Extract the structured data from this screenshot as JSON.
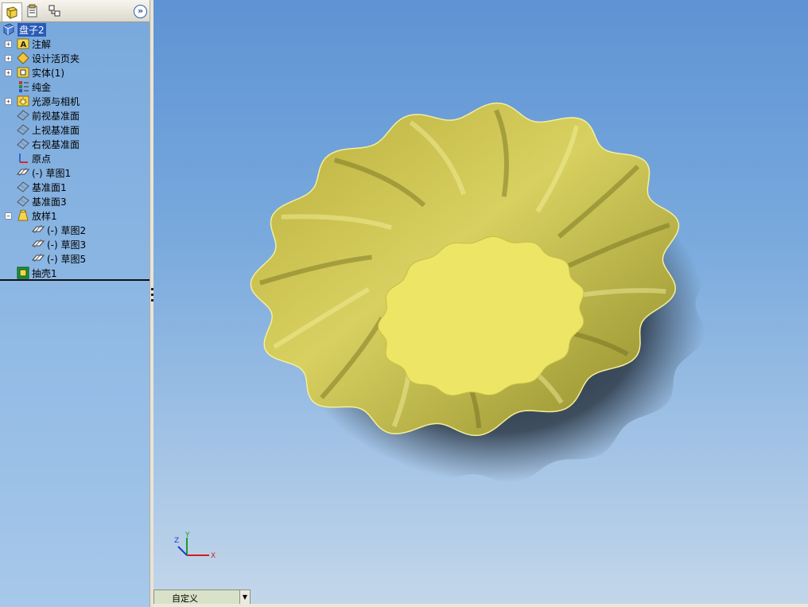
{
  "panel_tabs": [
    {
      "name": "feature-manager-tab"
    },
    {
      "name": "property-manager-tab"
    },
    {
      "name": "configuration-manager-tab"
    }
  ],
  "expand_label": "»",
  "tree": {
    "root": "盘子2",
    "items": [
      {
        "label": "注解",
        "icon": "annotations-icon",
        "toggle": "+"
      },
      {
        "label": "设计活页夹",
        "icon": "design-binder-icon",
        "toggle": "+"
      },
      {
        "label": "实体(1)",
        "icon": "solid-bodies-icon",
        "toggle": "+"
      },
      {
        "label": "纯金",
        "icon": "material-icon",
        "toggle": ""
      },
      {
        "label": "光源与相机",
        "icon": "lights-cameras-icon",
        "toggle": "+"
      },
      {
        "label": "前视基准面",
        "icon": "plane-icon",
        "toggle": ""
      },
      {
        "label": "上视基准面",
        "icon": "plane-icon",
        "toggle": ""
      },
      {
        "label": "右视基准面",
        "icon": "plane-icon",
        "toggle": ""
      },
      {
        "label": "原点",
        "icon": "origin-icon",
        "toggle": ""
      },
      {
        "label": "(-) 草图1",
        "icon": "sketch-icon",
        "toggle": ""
      },
      {
        "label": "基准面1",
        "icon": "plane-icon",
        "toggle": ""
      },
      {
        "label": "基准面3",
        "icon": "plane-icon",
        "toggle": ""
      },
      {
        "label": "放样1",
        "icon": "loft-icon",
        "toggle": "−"
      },
      {
        "label": "(-) 草图2",
        "icon": "sketch-icon",
        "toggle": "",
        "indent": 1
      },
      {
        "label": "(-) 草图3",
        "icon": "sketch-icon",
        "toggle": "",
        "indent": 1
      },
      {
        "label": "(-) 草图5",
        "icon": "sketch-icon",
        "toggle": "",
        "indent": 1
      },
      {
        "label": "抽壳1",
        "icon": "shell-icon",
        "toggle": ""
      }
    ]
  },
  "triad": {
    "x": "X",
    "y": "Y",
    "z": "Z"
  },
  "view_orientation": "自定义",
  "colors": {
    "model": "#e8e26a",
    "selection": "#2b5bb8",
    "viewport_top": "#5e93d4"
  }
}
